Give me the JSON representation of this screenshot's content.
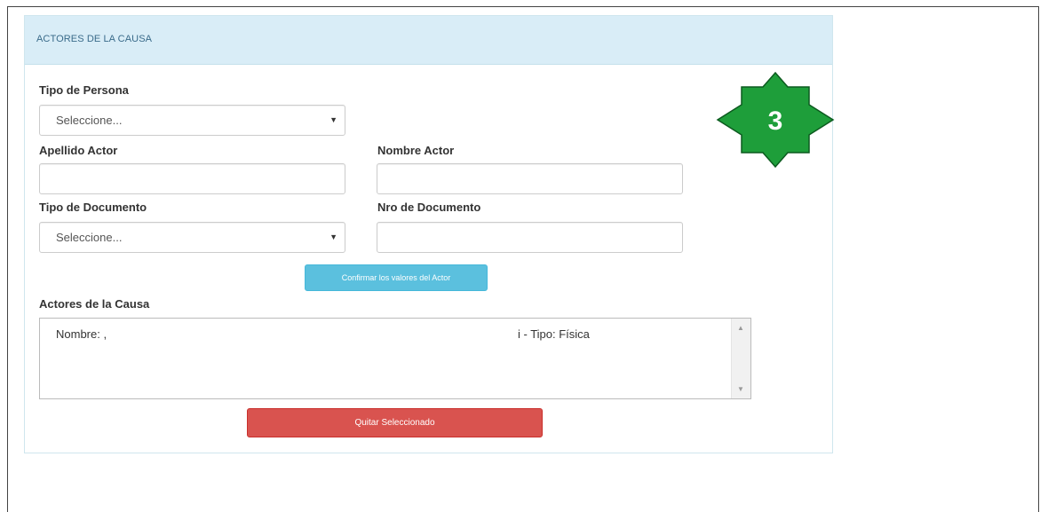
{
  "panel": {
    "title": "ACTORES DE LA CAUSA"
  },
  "form": {
    "tipo_persona": {
      "label": "Tipo de Persona",
      "selected": "Seleccione..."
    },
    "apellido": {
      "label": "Apellido Actor",
      "value": ""
    },
    "nombre": {
      "label": "Nombre Actor",
      "value": ""
    },
    "tipo_documento": {
      "label": "Tipo de Documento",
      "selected": "Seleccione..."
    },
    "nro_documento": {
      "label": "Nro de Documento",
      "value": ""
    },
    "confirm_button": "Confirmar los valores del Actor"
  },
  "actores": {
    "label": "Actores de la Causa",
    "items": [
      {
        "left": "Nombre: ,",
        "right": "i - Tipo: Física"
      }
    ],
    "remove_button": "Quitar Seleccionado"
  },
  "step_badge": {
    "number": "3",
    "color": "#1e9e3a"
  },
  "icons": {
    "caret": "caret-down-icon",
    "scroll_up": "scroll-up-arrow-icon",
    "scroll_down": "scroll-down-arrow-icon"
  }
}
